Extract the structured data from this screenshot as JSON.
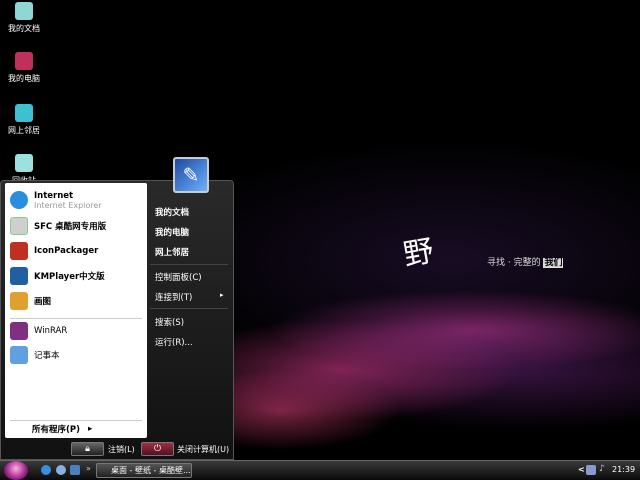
{
  "desktop": {
    "icons": [
      {
        "label": "我的文档",
        "color": "#8fd6d6"
      },
      {
        "label": "我的电脑",
        "color": "#c0305a"
      },
      {
        "label": "网上邻居",
        "color": "#3fc0d0"
      },
      {
        "label": "回收站",
        "color": "#9de0e0"
      }
    ],
    "wallpaper": {
      "signature": "野",
      "slogan": "寻找 · 完整的",
      "slogan_highlight": "我们"
    }
  },
  "start_menu": {
    "user_icon": "user-picture",
    "pinned": [
      {
        "label": "Internet",
        "sub": "Internet Explorer",
        "icon": "ie-icon",
        "color": "#2a8ee0"
      },
      {
        "label": "SFC 桌酷网专用版",
        "icon": "sfc-icon",
        "color": "#cfcfcf"
      }
    ],
    "recent": [
      {
        "label": "IconPackager",
        "icon": "iconpackager-icon",
        "color": "#c03020"
      },
      {
        "label": "KMPlayer中文版",
        "icon": "kmplayer-icon",
        "color": "#2060a0"
      },
      {
        "label": "画图",
        "icon": "paint-icon",
        "color": "#e0a030"
      },
      {
        "label": "WinRAR",
        "icon": "winrar-icon",
        "color": "#803080"
      },
      {
        "label": "记事本",
        "icon": "notepad-icon",
        "color": "#60a0e0"
      }
    ],
    "all_programs": "所有程序(P)",
    "places": [
      "我的文档",
      "我的电脑",
      "网上邻居",
      "控制面板(C)",
      "连接到(T)",
      "搜索(S)",
      "运行(R)..."
    ],
    "logoff": "注销(L)",
    "shutdown": "关闭计算机(U)"
  },
  "taskbar": {
    "task": "桌面 - 壁纸 - 桌酷壁...",
    "clock": "21:39",
    "expand": "»",
    "tray_arrow": "<"
  }
}
